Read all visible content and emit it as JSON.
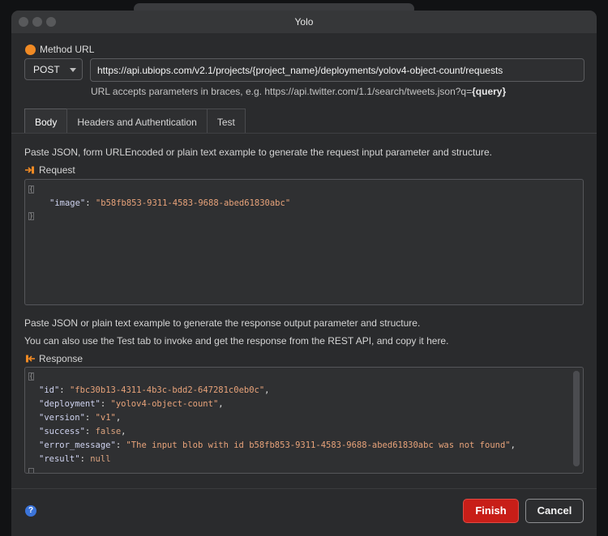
{
  "window": {
    "title": "Yolo"
  },
  "method_url": {
    "label": "Method URL",
    "method": "POST",
    "url": "https://api.ubiops.com/v2.1/projects/{project_name}/deployments/yolov4-object-count/requests",
    "hint_prefix": "URL accepts parameters in braces, e.g. https://api.twitter.com/1.1/search/tweets.json?q=",
    "hint_param": "{query}"
  },
  "tabs": [
    "Body",
    "Headers and Authentication",
    "Test"
  ],
  "body": {
    "request_description": "Paste JSON, form URLEncoded or plain text example to generate the request input parameter and structure.",
    "request_label": "Request",
    "request_json": {
      "open": "{",
      "key": "\"image\"",
      "value": "\"b58fb853-9311-4583-9688-abed61830abc\"",
      "close": "}"
    },
    "response_description_1": "Paste JSON or plain text example to generate the response output parameter and structure.",
    "response_description_2": "You can also use the Test tab to invoke and get the response from the REST API, and copy it here.",
    "response_label": "Response",
    "response_json": {
      "open": "{",
      "lines": [
        {
          "key": "\"id\"",
          "value": "\"fbc30b13-4311-4b3c-bdd2-647281c0eb0c\"",
          "comma": ","
        },
        {
          "key": "\"deployment\"",
          "value": "\"yolov4-object-count\"",
          "comma": ","
        },
        {
          "key": "\"version\"",
          "value": "\"v1\"",
          "comma": ","
        },
        {
          "key": "\"success\"",
          "value": "false",
          "comma": ","
        },
        {
          "key": "\"error_message\"",
          "value": "\"The input blob with id b58fb853-9311-4583-9688-abed61830abc was not found\"",
          "comma": ","
        },
        {
          "key": "\"result\"",
          "value": "null",
          "comma": ""
        }
      ]
    }
  },
  "footer": {
    "help": "?",
    "finish_label": "Finish",
    "cancel_label": "Cancel"
  },
  "colors": {
    "accent_orange": "#f08a24",
    "finish_red": "#c81e18",
    "help_blue": "#3b74d9"
  }
}
